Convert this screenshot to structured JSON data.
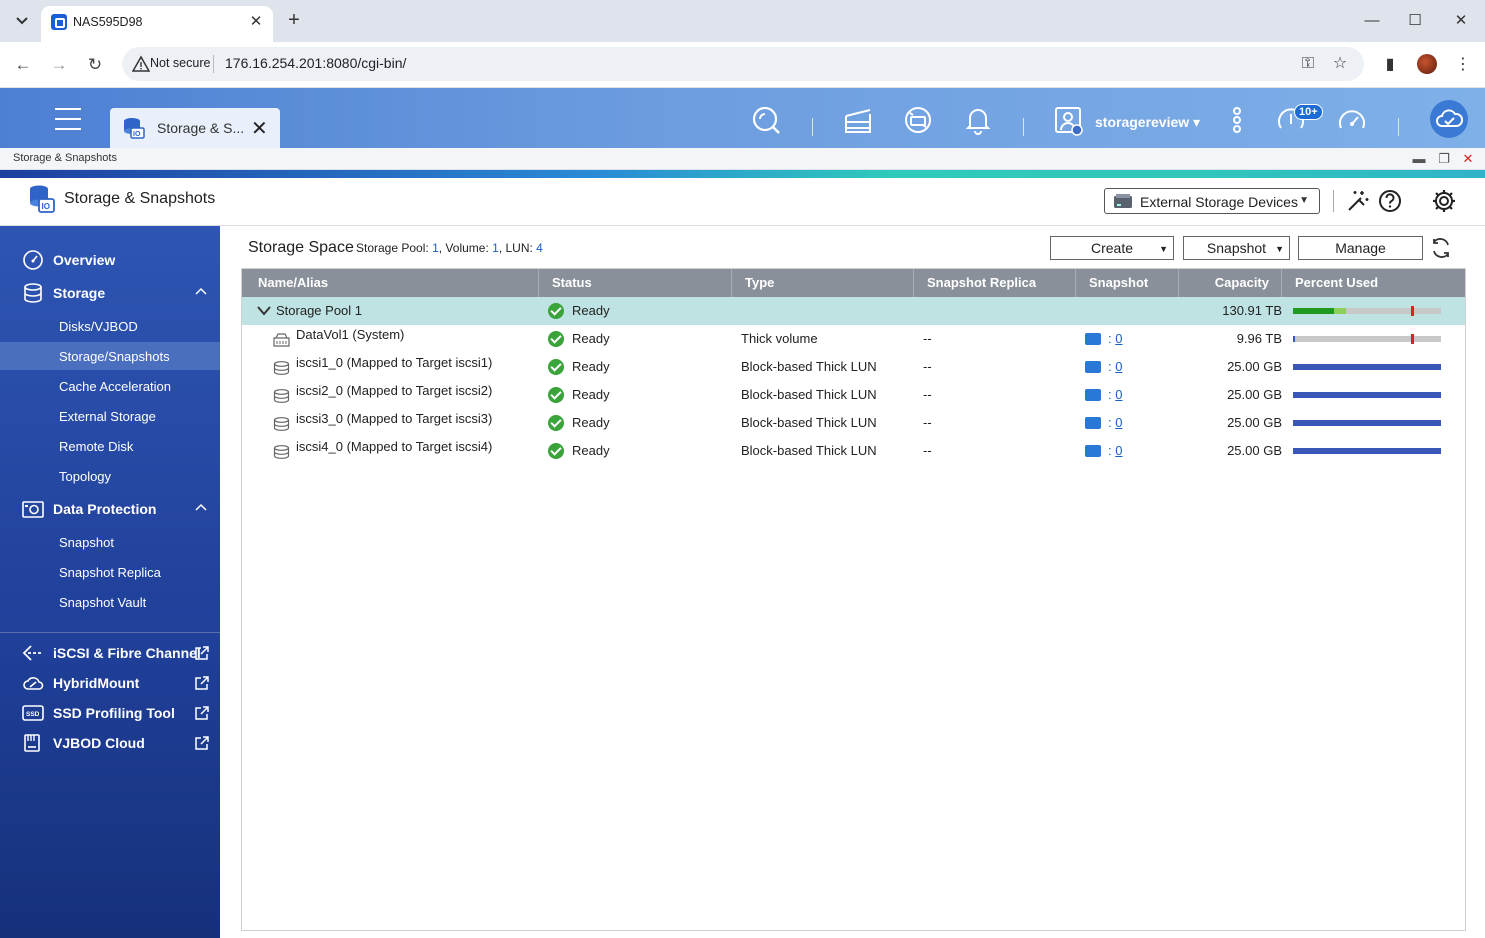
{
  "browser": {
    "tab_title": "NAS595D98",
    "not_secure": "Not secure",
    "url": "176.16.254.201:8080/cgi-bin/"
  },
  "qts": {
    "app_tab_label": "Storage & S...",
    "username": "storagereview",
    "notification_badge": "10+"
  },
  "window": {
    "title": "Storage & Snapshots",
    "app_title": "Storage & Snapshots",
    "device_selector": "External Storage Devices"
  },
  "sidebar": {
    "overview": "Overview",
    "storage": "Storage",
    "storage_items": [
      "Disks/VJBOD",
      "Storage/Snapshots",
      "Cache Acceleration",
      "External Storage",
      "Remote Disk",
      "Topology"
    ],
    "data_protection": "Data Protection",
    "dp_items": [
      "Snapshot",
      "Snapshot Replica",
      "Snapshot Vault"
    ],
    "external_links": [
      "iSCSI & Fibre Channel",
      "HybridMount",
      "SSD Profiling Tool",
      "VJBOD Cloud"
    ]
  },
  "content": {
    "title": "Storage Space",
    "summary_pool_label": "Storage Pool:",
    "summary_pool": "1",
    "summary_volume_label": "Volume:",
    "summary_volume": "1",
    "summary_lun_label": "LUN:",
    "summary_lun": "4",
    "buttons": {
      "create": "Create",
      "snapshot": "Snapshot",
      "manage": "Manage"
    },
    "columns": [
      "Name/Alias",
      "Status",
      "Type",
      "Snapshot Replica",
      "Snapshot",
      "Capacity",
      "Percent Used"
    ],
    "rows": [
      {
        "name": "Storage Pool 1",
        "status": "Ready",
        "type": "",
        "replica": "",
        "snapshot": "",
        "capacity": "130.91 TB"
      },
      {
        "name": "DataVol1 (System)",
        "status": "Ready",
        "type": "Thick volume",
        "replica": "--",
        "snapshot": "0",
        "capacity": "9.96 TB"
      },
      {
        "name": "iscsi1_0 (Mapped to Target iscsi1)",
        "status": "Ready",
        "type": "Block-based Thick LUN",
        "replica": "--",
        "snapshot": "0",
        "capacity": "25.00 GB"
      },
      {
        "name": "iscsi2_0 (Mapped to Target iscsi2)",
        "status": "Ready",
        "type": "Block-based Thick LUN",
        "replica": "--",
        "snapshot": "0",
        "capacity": "25.00 GB"
      },
      {
        "name": "iscsi3_0 (Mapped to Target iscsi3)",
        "status": "Ready",
        "type": "Block-based Thick LUN",
        "replica": "--",
        "snapshot": "0",
        "capacity": "25.00 GB"
      },
      {
        "name": "iscsi4_0 (Mapped to Target iscsi4)",
        "status": "Ready",
        "type": "Block-based Thick LUN",
        "replica": "--",
        "snapshot": "0",
        "capacity": "25.00 GB"
      }
    ],
    "usage": {
      "pool": {
        "used_green": 0.28,
        "used_light": 0.08,
        "threshold": 0.8
      },
      "datavol": {
        "used": 0.01,
        "threshold": 0.8
      },
      "lun": {
        "used": 1.0
      }
    }
  },
  "colors": {
    "pool_row": "#bfe3e3",
    "header_row": "#8a9099",
    "accent": "#1b5fc4",
    "lun_bar": "#3a57b8",
    "pool_bar_green": "#1e9a1e",
    "pool_bar_light": "#8ccf5a",
    "threshold": "#e02020"
  }
}
